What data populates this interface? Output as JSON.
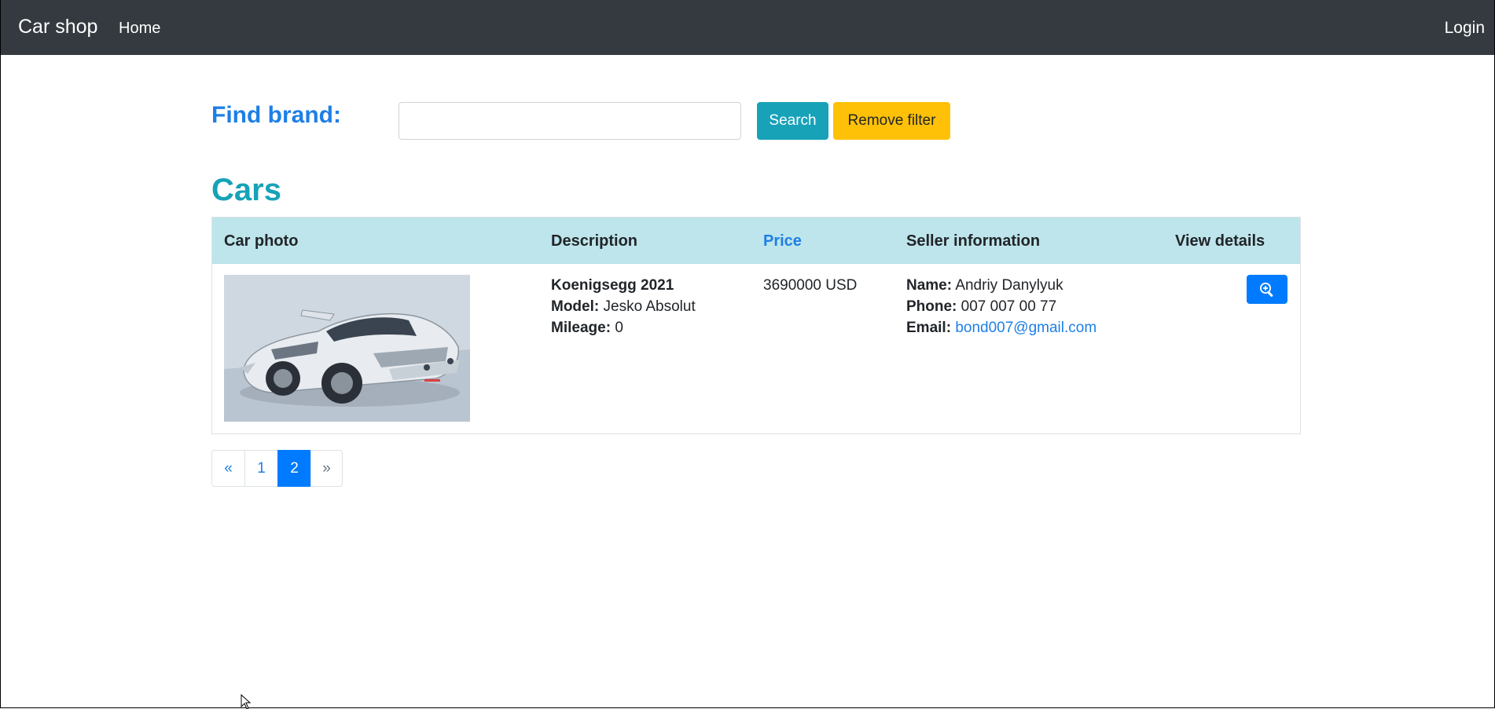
{
  "navbar": {
    "brand": "Car shop",
    "home": "Home",
    "login": "Login"
  },
  "search": {
    "label": "Find brand:",
    "value": "",
    "placeholder": "",
    "search_button": "Search",
    "remove_filter_button": "Remove filter"
  },
  "heading": "Cars",
  "table": {
    "headers": [
      "Car photo",
      "Description",
      "Price",
      "Seller information",
      "View details"
    ],
    "rows": [
      {
        "title": "Koenigsegg 2021",
        "model_label": "Model:",
        "model": "Jesko Absolut",
        "mileage_label": "Mileage:",
        "mileage": "0",
        "price": "3690000 USD",
        "name_label": "Name:",
        "name": "Andriy Danylyuk",
        "phone_label": "Phone:",
        "phone": "007 007 00 77",
        "email_label": "Email:",
        "email": "bond007@gmail.com",
        "view_icon": "zoom-in-icon",
        "photo_icon": "car-photo"
      }
    ]
  },
  "pagination": {
    "prev": "«",
    "pages": [
      "1",
      "2"
    ],
    "active_page": "2",
    "next": "»"
  },
  "colors": {
    "navbar": "#343a40",
    "accent_blue": "#1e7fe6",
    "info": "#17a2b8",
    "warning": "#ffc107",
    "primary": "#007bff",
    "table_header": "#bee5eb"
  }
}
